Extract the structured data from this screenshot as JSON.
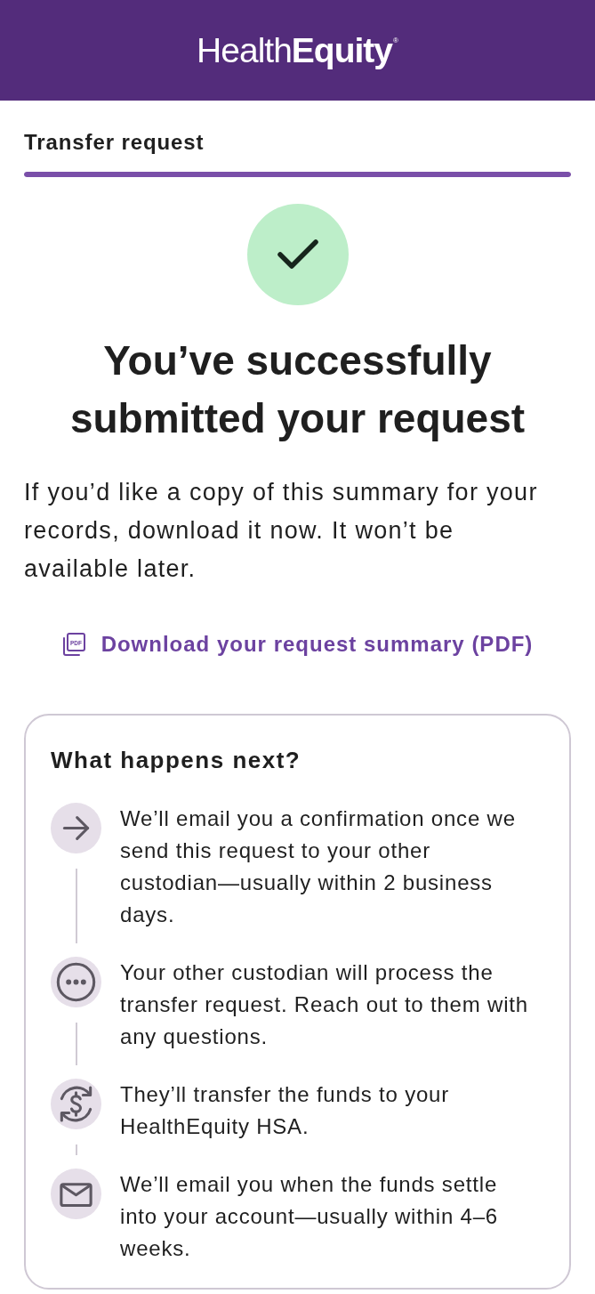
{
  "header": {
    "logo": "Health**Equity**$^{®}$"
  },
  "page": {
    "title": "Transfer request"
  },
  "progress": {
    "level": 1
  },
  "confirmation": {
    "heading": "You’ve successfully submitted your request",
    "message": "If you’d like a copy of this summary for your records, download it now. It won’t be available later."
  },
  "download_link": {
    "icon_text": "PDF",
    "label": "Download your request summary (PDF)"
  },
  "next_steps": {
    "title": "What happens next?",
    "steps": [
      {
        "text": "We’ll email you a confirmation once we send this request to your other custodian—usually within 2 business days."
      },
      {
        "text": "Your other custodian will process the transfer request. Reach out to them with any questions."
      },
      {
        "text": "They’ll transfer the funds to your HealthEquity HSA."
      },
      {
        "text": "We’ll email you when the funds settle into your account—usually within 4–6 weeks."
      }
    ]
  }
}
